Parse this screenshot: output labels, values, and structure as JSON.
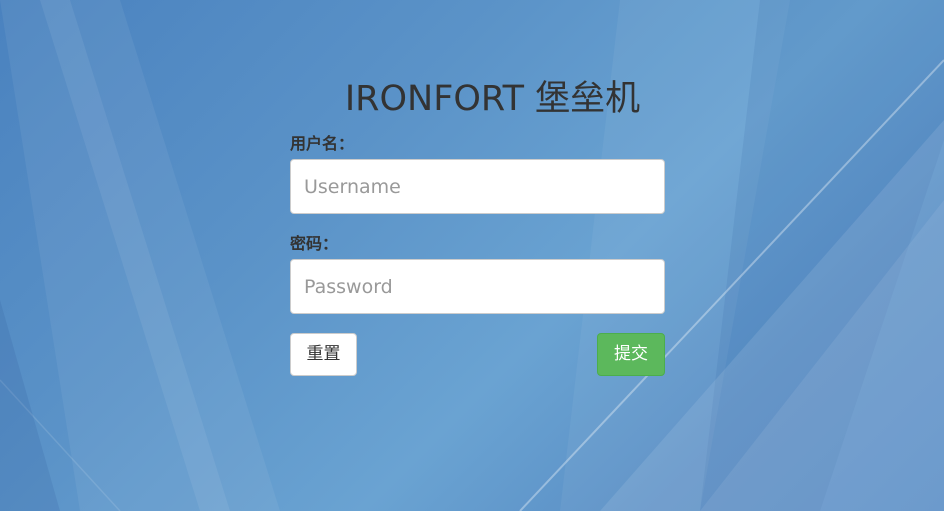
{
  "login": {
    "title": "IRONFORT 堡垒机",
    "username_label": "用户名：",
    "username_placeholder": "Username",
    "username_value": "",
    "password_label": "密码：",
    "password_placeholder": "Password",
    "password_value": "",
    "reset_label": "重置",
    "submit_label": "提交"
  },
  "colors": {
    "background": "#5b93c8",
    "submit_button": "#5cb85c",
    "text": "#333333"
  }
}
